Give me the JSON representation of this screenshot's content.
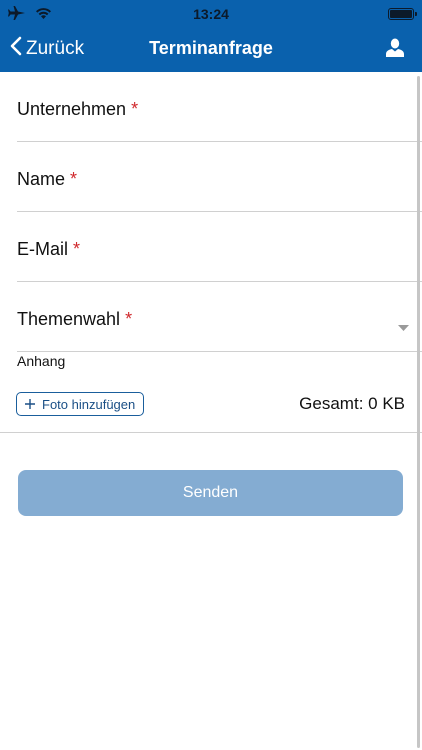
{
  "status_bar": {
    "time": "13:24",
    "icons": [
      "airplane-icon",
      "wifi-icon",
      "battery-icon"
    ]
  },
  "nav": {
    "back_label": "Zurück",
    "title": "Terminanfrage",
    "right_icon": "user-icon"
  },
  "form": {
    "required_marker": "*",
    "fields": [
      {
        "label": "Unternehmen",
        "value": ""
      },
      {
        "label": "Name",
        "value": ""
      },
      {
        "label": "E-Mail",
        "value": ""
      },
      {
        "label": "Themenwahl",
        "value": ""
      }
    ]
  },
  "attachment": {
    "label": "Anhang",
    "add_button": "Foto hinzufügen",
    "total": "Gesamt: 0 KB"
  },
  "submit_label": "Senden",
  "colors": {
    "header": "#0a61ad",
    "required": "#d0282c",
    "submit_disabled": "#84acd2"
  }
}
